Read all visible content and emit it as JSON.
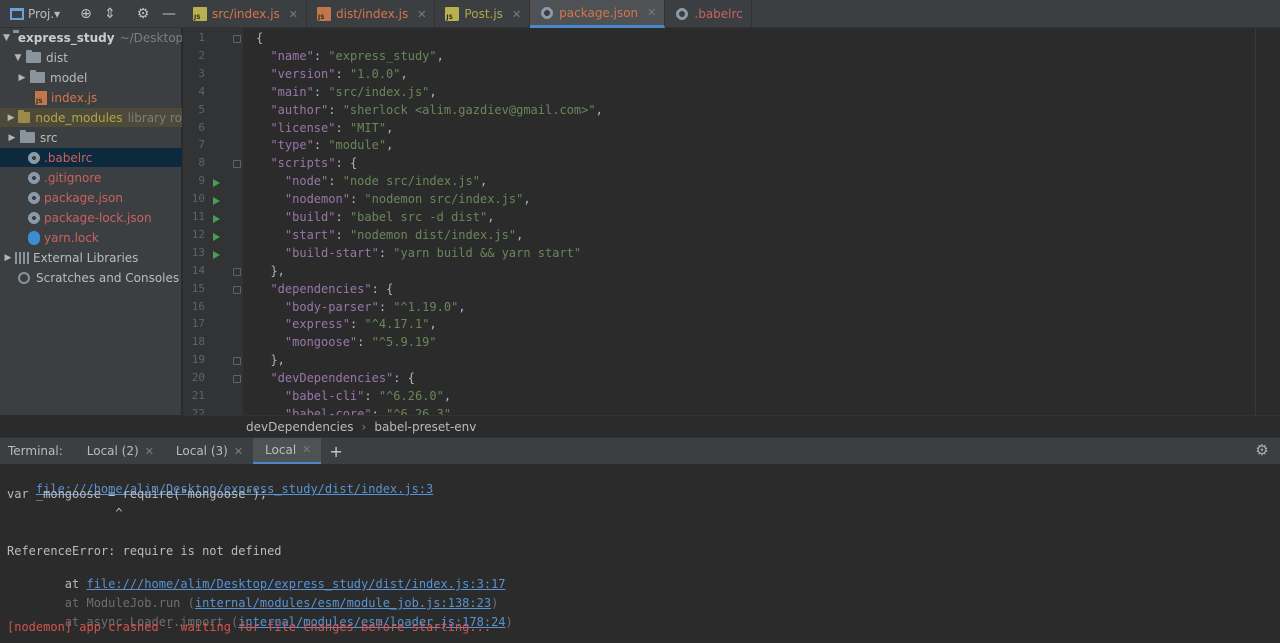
{
  "project_header": {
    "title": "Proj.▾"
  },
  "tabs": [
    {
      "label": "src/index.js",
      "icon": "js-file-icon",
      "color": "#d3764a",
      "active": false
    },
    {
      "label": "dist/index.js",
      "icon": "js-file-icon",
      "color": "#d3764a",
      "active": false
    },
    {
      "label": "Post.js",
      "icon": "js-file-icon",
      "color": "#b4a548",
      "active": false
    },
    {
      "label": "package.json",
      "icon": "config-file-icon",
      "color": "#d3764a",
      "active": true
    },
    {
      "label": ".babelrc",
      "icon": "config-file-icon",
      "color": "#c96160",
      "active": false
    }
  ],
  "tree": {
    "root_name": "express_study",
    "root_path": "~/Desktop",
    "items": [
      {
        "label": "dist"
      },
      {
        "label": "model"
      },
      {
        "label": "index.js"
      },
      {
        "label": "node_modules",
        "note": "library ro"
      },
      {
        "label": "src"
      },
      {
        "label": ".babelrc"
      },
      {
        "label": ".gitignore"
      },
      {
        "label": "package.json"
      },
      {
        "label": "package-lock.json"
      },
      {
        "label": "yarn.lock"
      },
      {
        "label": "External Libraries"
      },
      {
        "label": "Scratches and Consoles"
      }
    ]
  },
  "editor": {
    "line_numbers": [
      "1",
      "2",
      "3",
      "4",
      "5",
      "6",
      "7",
      "8",
      "9",
      "10",
      "11",
      "12",
      "13",
      "14",
      "15",
      "16",
      "17",
      "18",
      "19",
      "20",
      "21",
      "22"
    ],
    "lines": [
      {
        "indent": "",
        "k": "",
        "v": "",
        "p": "{"
      },
      {
        "indent": "  ",
        "k": "\"name\"",
        "v": "\"express_study\"",
        "p": ","
      },
      {
        "indent": "  ",
        "k": "\"version\"",
        "v": "\"1.0.0\"",
        "p": ","
      },
      {
        "indent": "  ",
        "k": "\"main\"",
        "v": "\"src/index.js\"",
        "p": ","
      },
      {
        "indent": "  ",
        "k": "\"author\"",
        "v": "\"sherlock <alim.gazdiev@gmail.com>\"",
        "p": ","
      },
      {
        "indent": "  ",
        "k": "\"license\"",
        "v": "\"MIT\"",
        "p": ","
      },
      {
        "indent": "  ",
        "k": "\"type\"",
        "v": "\"module\"",
        "p": ","
      },
      {
        "indent": "  ",
        "k": "\"scripts\"",
        "v": "",
        "p": " {"
      },
      {
        "indent": "    ",
        "k": "\"node\"",
        "v": "\"node src/index.js\"",
        "p": ","
      },
      {
        "indent": "    ",
        "k": "\"nodemon\"",
        "v": "\"nodemon src/index.js\"",
        "p": ","
      },
      {
        "indent": "    ",
        "k": "\"build\"",
        "v": "\"babel src -d dist\"",
        "p": ","
      },
      {
        "indent": "    ",
        "k": "\"start\"",
        "v": "\"nodemon dist/index.js\"",
        "p": ","
      },
      {
        "indent": "    ",
        "k": "\"build-start\"",
        "v": "\"yarn build && yarn start\"",
        "p": ""
      },
      {
        "indent": "  ",
        "k": "",
        "v": "",
        "p": "},"
      },
      {
        "indent": "  ",
        "k": "\"dependencies\"",
        "v": "",
        "p": " {"
      },
      {
        "indent": "    ",
        "k": "\"body-parser\"",
        "v": "\"^1.19.0\"",
        "p": ","
      },
      {
        "indent": "    ",
        "k": "\"express\"",
        "v": "\"^4.17.1\"",
        "p": ","
      },
      {
        "indent": "    ",
        "k": "\"mongoose\"",
        "v": "\"^5.9.19\"",
        "p": ""
      },
      {
        "indent": "  ",
        "k": "",
        "v": "",
        "p": "},"
      },
      {
        "indent": "  ",
        "k": "\"devDependencies\"",
        "v": "",
        "p": " {"
      },
      {
        "indent": "    ",
        "k": "\"babel-cli\"",
        "v": "\"^6.26.0\"",
        "p": ","
      },
      {
        "indent": "    ",
        "k": "\"babel-core\"",
        "v": "\"^6.26.3\"",
        "p": ","
      }
    ]
  },
  "breadcrumbs": [
    "devDependencies",
    "babel-preset-env"
  ],
  "terminal": {
    "title": "Terminal:",
    "tabs": [
      {
        "label": "Local (2)",
        "active": false
      },
      {
        "label": "Local (3)",
        "active": false
      },
      {
        "label": "Local",
        "active": true
      }
    ],
    "output": {
      "l1_link": "file:///home/alim/Desktop/express_study/dist/index.js:3",
      "l2": "var _mongoose = require(\"mongoose\");",
      "l3": "               ^",
      "l5": "ReferenceError: require is not defined",
      "l6_prefix": "    at ",
      "l6_link": "file:///home/alim/Desktop/express_study/dist/index.js:3:17",
      "l7_prefix": "    at ModuleJob.run (",
      "l7_link": "internal/modules/esm/module_job.js:138:23",
      "l7_suffix": ")",
      "l8_prefix": "    at async Loader.import (",
      "l8_link": "internal/modules/esm/loader.js:178:24",
      "l8_suffix": ")",
      "l9": "[nodemon] app crashed - waiting for file changes before starting..."
    }
  }
}
